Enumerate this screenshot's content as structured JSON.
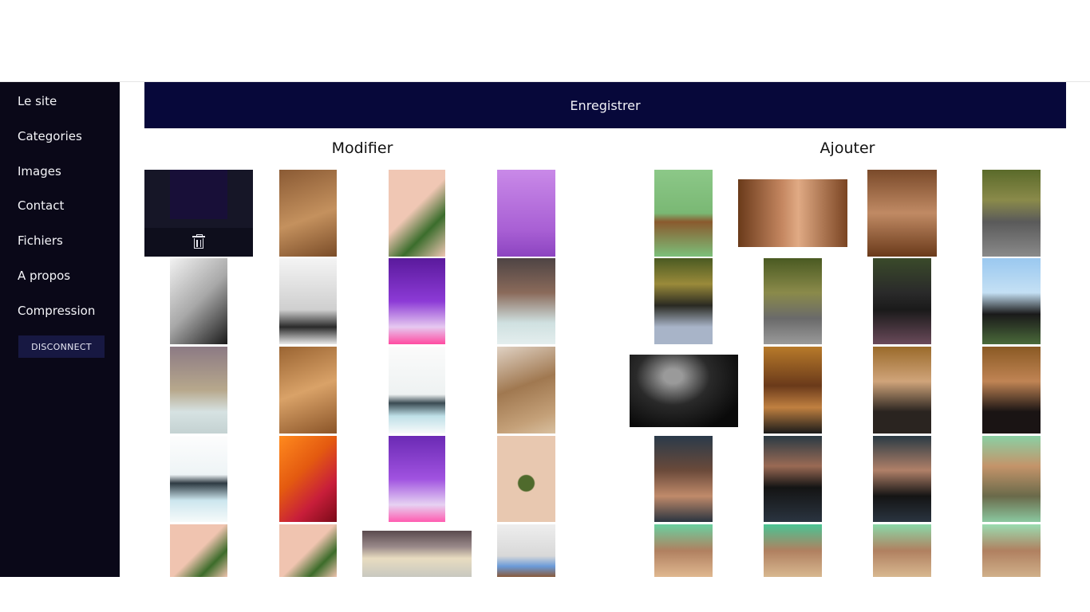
{
  "sidebar": {
    "items": [
      {
        "label": "Le site"
      },
      {
        "label": "Categories"
      },
      {
        "label": "Images"
      },
      {
        "label": "Contact"
      },
      {
        "label": "Fichiers"
      },
      {
        "label": "A propos"
      },
      {
        "label": "Compression"
      }
    ],
    "disconnect_label": "DISCONNECT"
  },
  "header": {
    "save_label": "Enregistrer"
  },
  "sections": {
    "modify_title": "Modifier",
    "add_title": "Ajouter"
  },
  "colors": {
    "sidebar_bg": "#0a0818",
    "save_bar_bg": "#07083a",
    "disconnect_bg": "#171842"
  },
  "icons": {
    "delete": "trash-icon"
  }
}
